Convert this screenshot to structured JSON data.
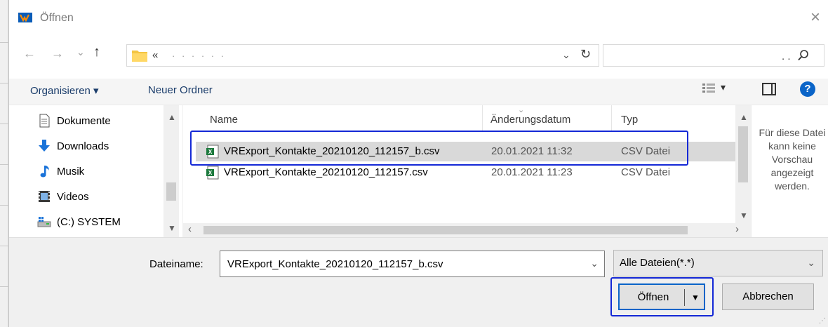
{
  "window": {
    "title": "Öffnen",
    "close_glyph": "×"
  },
  "nav": {
    "back_glyph": "←",
    "forward_glyph": "→",
    "recent_glyph": "⌄",
    "up_glyph": "↑",
    "address_prefix": "«",
    "address_obscured": "· · ·      · · ·",
    "address_chevron": "⌄",
    "refresh_glyph": "↻",
    "search_dots": ". ."
  },
  "toolbar": {
    "organize_label": "Organisieren ▾",
    "new_folder_label": "Neuer Ordner",
    "view_glyph": "▾",
    "help_glyph": "?"
  },
  "sidebar": {
    "items": [
      {
        "label": "Dokumente",
        "icon": "documents-icon"
      },
      {
        "label": "Downloads",
        "icon": "downloads-icon"
      },
      {
        "label": "Musik",
        "icon": "music-icon"
      },
      {
        "label": "Videos",
        "icon": "videos-icon"
      },
      {
        "label": "(C:) SYSTEM",
        "icon": "drive-icon"
      }
    ]
  },
  "filelist": {
    "columns": {
      "name": "Name",
      "date": "Änderungsdatum",
      "type": "Typ"
    },
    "rows": [
      {
        "name": "VRExport_Kontakte_20210120_112157_b.csv",
        "date": "20.01.2021 11:32",
        "type": "CSV Datei",
        "selected": true
      },
      {
        "name": "VRExport_Kontakte_20210120_112157.csv",
        "date": "20.01.2021 11:23",
        "type": "CSV Datei",
        "selected": false
      }
    ]
  },
  "preview": {
    "message": "Für diese Datei kann keine Vorschau angezeigt werden."
  },
  "footer": {
    "filename_label": "Dateiname:",
    "filename_value": "VRExport_Kontakte_20210120_112157_b.csv",
    "filetype_value": "Alle Dateien(*.*)",
    "open_label": "Öffnen",
    "cancel_label": "Abbrechen"
  },
  "colors": {
    "accent": "#0a64c8",
    "highlight_box": "#1428d6",
    "selection": "#d9d9d9"
  }
}
